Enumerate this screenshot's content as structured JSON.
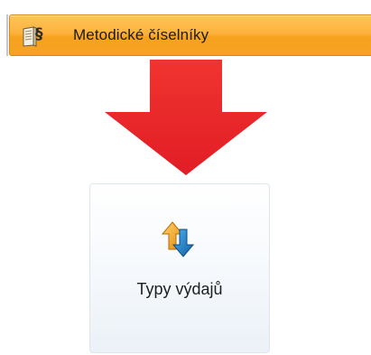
{
  "menu": {
    "label": "Metodické číselníky",
    "icon": "book-paragraph-icon",
    "colors": {
      "bar_top": "#ffc45a",
      "bar_bottom": "#f6a325",
      "border": "#d48a18"
    }
  },
  "arrow": {
    "icon": "down-arrow-icon",
    "color": "#e8262a"
  },
  "tile": {
    "label": "Typy výdajů",
    "icon": "swap-arrows-icon",
    "colors": {
      "up_arrow": "#f5a623",
      "down_arrow": "#1a7fc4"
    }
  }
}
